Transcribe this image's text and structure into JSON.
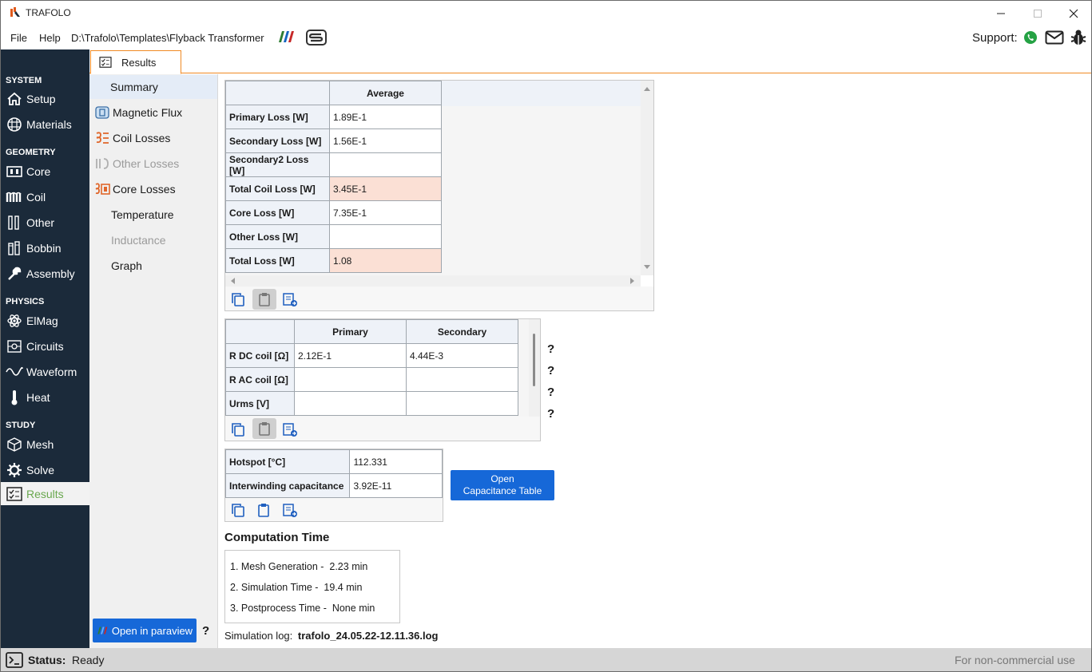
{
  "window": {
    "title": "TRAFOLO"
  },
  "menu": {
    "file": "File",
    "help": "Help",
    "path": "D:\\Trafolo\\Templates\\Flyback Transformer",
    "support_label": "Support:"
  },
  "sidebar": {
    "sections": {
      "system": "SYSTEM",
      "geometry": "GEOMETRY",
      "physics": "PHYSICS",
      "study": "STUDY"
    },
    "items": {
      "setup": "Setup",
      "materials": "Materials",
      "core": "Core",
      "coil": "Coil",
      "other": "Other",
      "bobbin": "Bobbin",
      "assembly": "Assembly",
      "elmag": "ElMag",
      "circuits": "Circuits",
      "waveform": "Waveform",
      "heat": "Heat",
      "mesh": "Mesh",
      "solve": "Solve",
      "results": "Results"
    }
  },
  "tab": {
    "results": "Results"
  },
  "subnav": {
    "summary": "Summary",
    "magnetic_flux": "Magnetic Flux",
    "coil_losses": "Coil Losses",
    "other_losses": "Other Losses",
    "core_losses": "Core Losses",
    "temperature": "Temperature",
    "inductance": "Inductance",
    "graph": "Graph"
  },
  "loss_table": {
    "column": "Average",
    "rows": [
      {
        "label": "Primary Loss [W]",
        "value": "1.89E-1"
      },
      {
        "label": "Secondary Loss [W]",
        "value": "1.56E-1"
      },
      {
        "label": "Secondary2 Loss [W]",
        "value": ""
      },
      {
        "label": "Total Coil Loss [W]",
        "value": "3.45E-1"
      },
      {
        "label": "Core Loss [W]",
        "value": "7.35E-1"
      },
      {
        "label": "Other Loss [W]",
        "value": ""
      },
      {
        "label": "Total Loss [W]",
        "value": "1.08"
      }
    ]
  },
  "coil_table": {
    "columns": [
      "Primary",
      "Secondary"
    ],
    "rows": [
      {
        "label": "R DC coil [Ω]",
        "primary": "2.12E-1",
        "secondary": "4.44E-3"
      },
      {
        "label": "R AC coil [Ω]",
        "primary": "",
        "secondary": ""
      },
      {
        "label": "Urms [V]",
        "primary": "",
        "secondary": ""
      }
    ],
    "help": "?"
  },
  "thermal_table": {
    "rows": [
      {
        "label": "Hotspot [°C]",
        "value": "112.331"
      },
      {
        "label": "Interwinding capacitance",
        "value": "3.92E-11"
      }
    ]
  },
  "capacitance_button": {
    "line1": "Open",
    "line2": "Capacitance Table"
  },
  "computation": {
    "title": "Computation Time",
    "lines": [
      {
        "label": "1. Mesh Generation -",
        "value": "2.23",
        "unit": "min"
      },
      {
        "label": "2. Simulation Time -",
        "value": "19.4",
        "unit": "min"
      },
      {
        "label": "3. Postprocess Time -",
        "value": "None",
        "unit": "min"
      }
    ]
  },
  "sim_log": {
    "label": "Simulation log:",
    "file": "trafolo_24.05.22-12.11.36.log"
  },
  "paraview": {
    "label": "Open in paraview",
    "help": "?"
  },
  "status": {
    "label": "Status:",
    "value": "Ready",
    "license": "For non-commercial use"
  },
  "colors": {
    "sidebar": "#1b2a3a",
    "accent": "#f08a24",
    "button": "#1668d8",
    "highlight": "#fbe0d5",
    "active_text": "#6aa84f"
  }
}
